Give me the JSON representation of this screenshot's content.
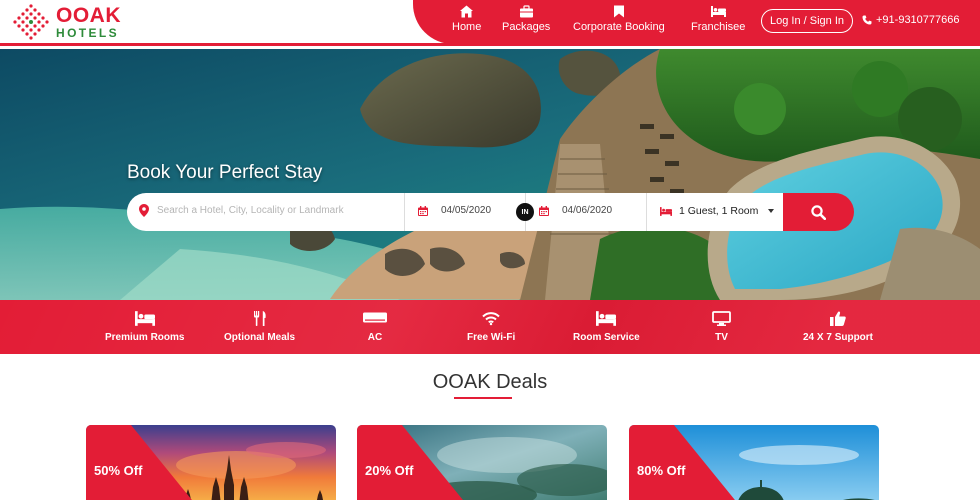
{
  "brand": {
    "name": "OOAK",
    "sub": "HOTELS"
  },
  "nav": {
    "items": [
      {
        "label": "Home",
        "icon": "home-icon"
      },
      {
        "label": "Packages",
        "icon": "briefcase-icon"
      },
      {
        "label": "Corporate Booking",
        "icon": "bookmark-icon"
      },
      {
        "label": "Franchisee",
        "icon": "bed-icon"
      }
    ],
    "login": "Log In / Sign In",
    "phone": "+91-9310777666"
  },
  "hero": {
    "title": "Book Your Perfect Stay",
    "search": {
      "placeholder": "Search a Hotel, City, Locality or Landmark",
      "checkin": "04/05/2020",
      "in_badge": "IN",
      "checkout": "04/06/2020",
      "guests": "1 Guest, 1 Room"
    }
  },
  "amenities": [
    {
      "label": "Premium Rooms",
      "icon": "bed-icon"
    },
    {
      "label": "Optional Meals",
      "icon": "cutlery-icon"
    },
    {
      "label": "AC",
      "icon": "ac-icon"
    },
    {
      "label": "Free Wi-Fi",
      "icon": "wifi-icon"
    },
    {
      "label": "Room Service",
      "icon": "bed-icon"
    },
    {
      "label": "TV",
      "icon": "tv-icon"
    },
    {
      "label": "24 X 7 Support",
      "icon": "thumbs-up-icon"
    }
  ],
  "deals": {
    "title": "OOAK Deals",
    "cards": [
      {
        "discount": "50% Off"
      },
      {
        "discount": "20% Off"
      },
      {
        "discount": "80% Off"
      }
    ]
  },
  "colors": {
    "accent": "#e31d36",
    "green": "#2e8b3a"
  }
}
